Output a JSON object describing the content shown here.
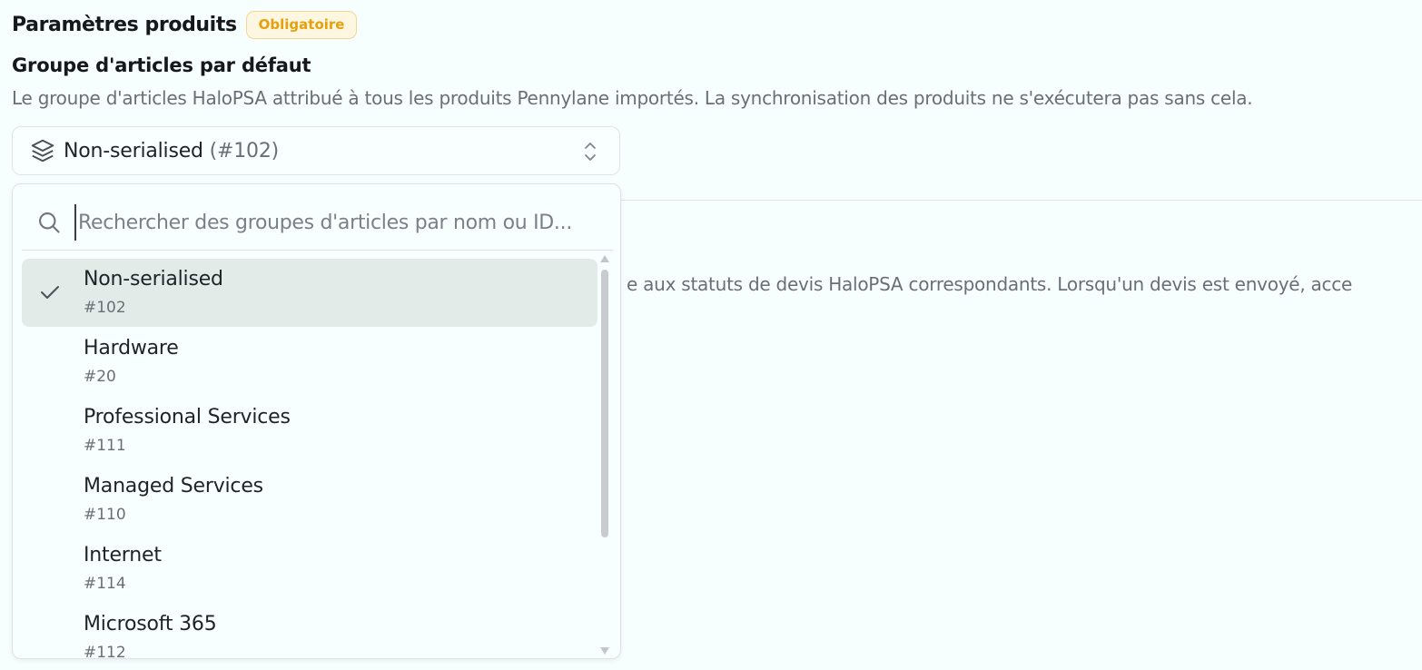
{
  "section": {
    "title": "Paramètres produits",
    "badge": "Obligatoire"
  },
  "field": {
    "label": "Groupe d'articles par défaut",
    "description": "Le groupe d'articles HaloPSA attribué à tous les produits Pennylane importés. La synchronisation des produits ne s'exécutera pas sans cela."
  },
  "select": {
    "icon": "layers-icon",
    "value_name": "Non-serialised",
    "value_id": "(#102)"
  },
  "background": {
    "partial_text": "e aux statuts de devis HaloPSA correspondants. Lorsqu'un devis est envoyé, acce"
  },
  "dropdown": {
    "search_placeholder": "Rechercher des groupes d'articles par nom ou ID...",
    "options": [
      {
        "name": "Non-serialised",
        "id": "#102",
        "selected": true
      },
      {
        "name": "Hardware",
        "id": "#20",
        "selected": false
      },
      {
        "name": "Professional Services",
        "id": "#111",
        "selected": false
      },
      {
        "name": "Managed Services",
        "id": "#110",
        "selected": false
      },
      {
        "name": "Internet",
        "id": "#114",
        "selected": false
      },
      {
        "name": "Microsoft 365",
        "id": "#112",
        "selected": false
      }
    ]
  },
  "colors": {
    "page_bg": "#f7fefe",
    "badge_text": "#e6a00d",
    "badge_bg": "#fdf7e2",
    "selected_bg": "#e3ebe9"
  }
}
